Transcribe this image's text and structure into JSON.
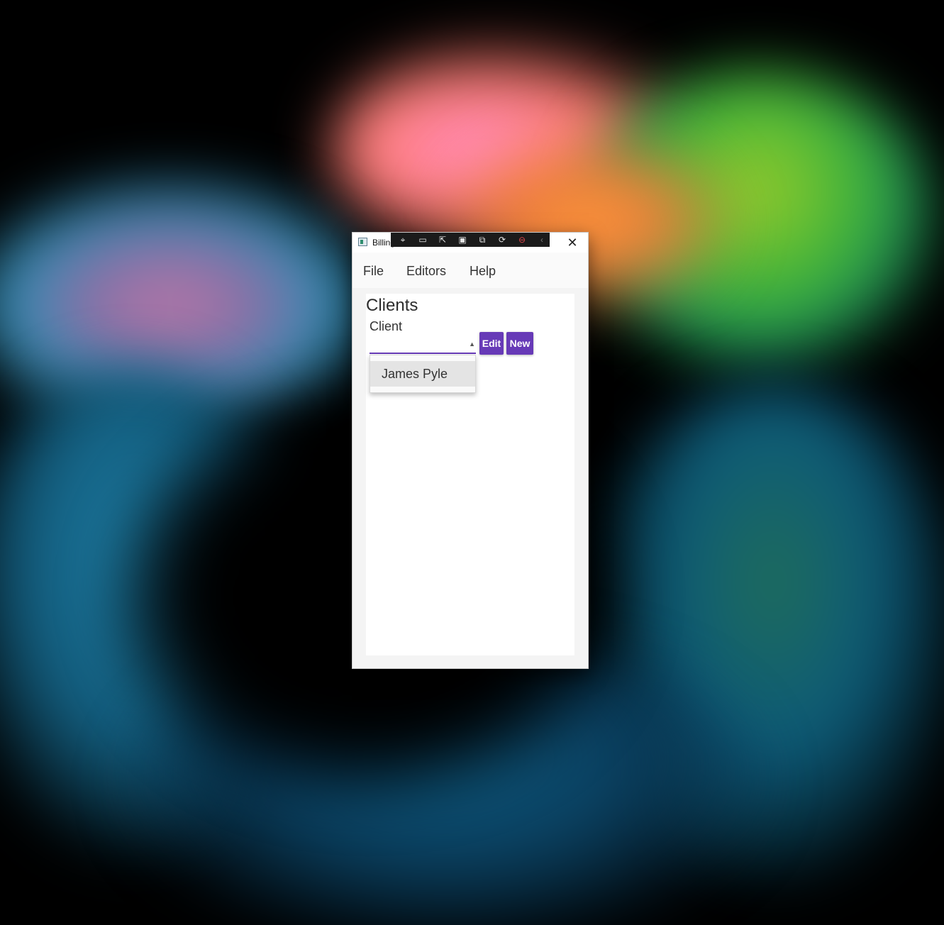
{
  "window": {
    "title": "Billing",
    "close_icon": "close-icon"
  },
  "devbar": {
    "icons": [
      "select-element-icon",
      "record-icon",
      "pointer-icon",
      "bounds-icon",
      "adorner-icon",
      "hot-reload-icon",
      "stop-icon",
      "collapse-chevron-icon"
    ]
  },
  "menu": {
    "file": "File",
    "editors": "Editors",
    "help": "Help"
  },
  "panel": {
    "title": "Clients",
    "client_label": "Client",
    "edit_label": "Edit",
    "new_label": "New"
  },
  "dropdown": {
    "items": [
      "James Pyle"
    ]
  },
  "colors": {
    "accent": "#673ab7"
  }
}
